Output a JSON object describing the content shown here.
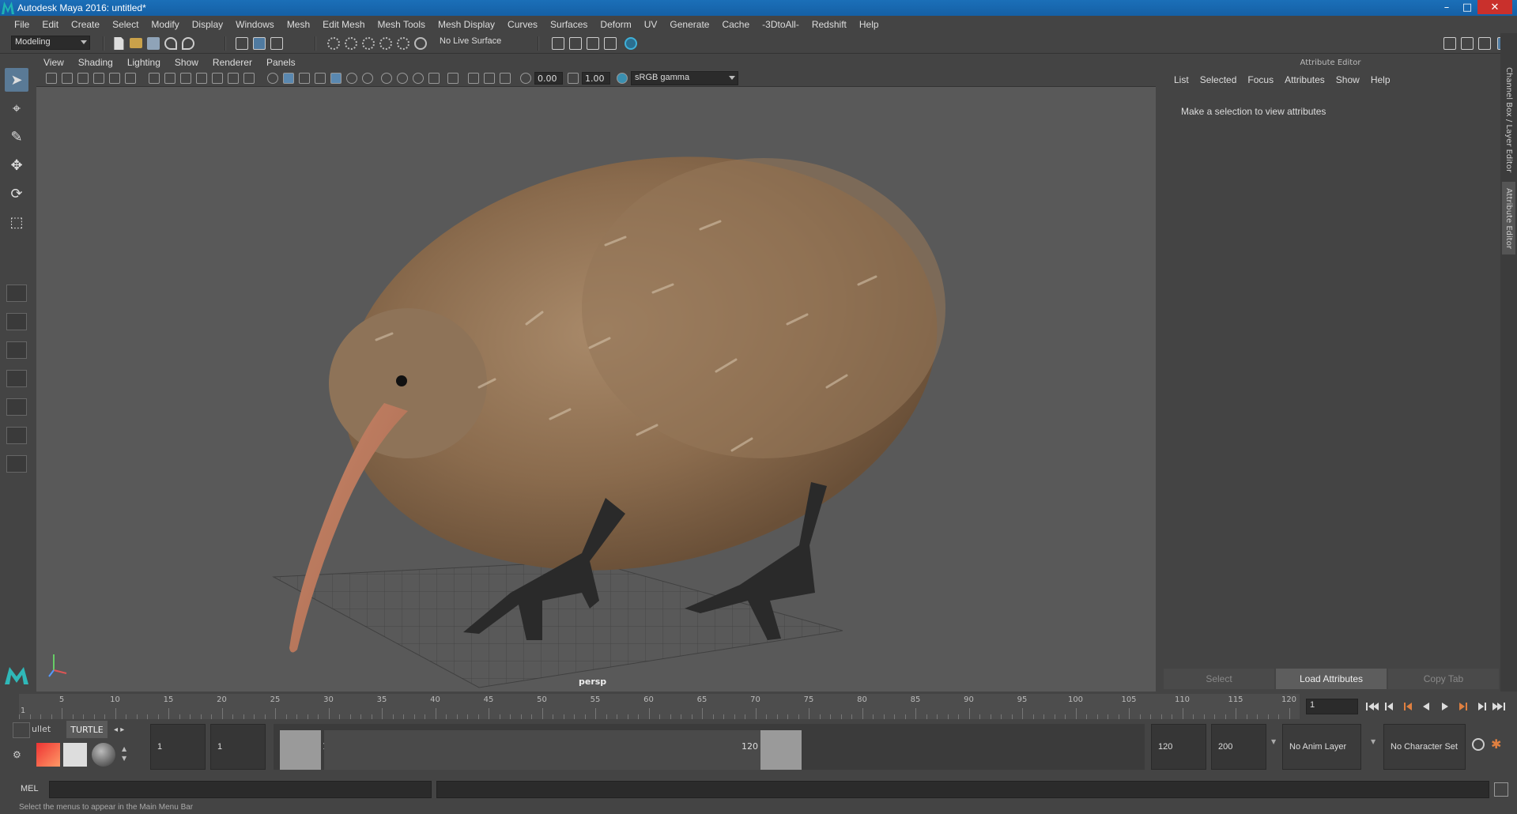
{
  "window": {
    "title": "Autodesk Maya 2016: untitled*"
  },
  "menus": [
    "File",
    "Edit",
    "Create",
    "Select",
    "Modify",
    "Display",
    "Windows",
    "Mesh",
    "Edit Mesh",
    "Mesh Tools",
    "Mesh Display",
    "Curves",
    "Surfaces",
    "Deform",
    "UV",
    "Generate",
    "Cache",
    "-3DtoAll-",
    "Redshift",
    "Help"
  ],
  "shelf": {
    "mode": "Modeling",
    "live_surface": "No Live Surface"
  },
  "viewport": {
    "menus": [
      "View",
      "Shading",
      "Lighting",
      "Show",
      "Renderer",
      "Panels"
    ],
    "exposure": "0.00",
    "gamma": "1.00",
    "colorspace": "sRGB gamma",
    "camera": "persp"
  },
  "attribute_editor": {
    "header": "Attribute Editor",
    "menus": [
      "List",
      "Selected",
      "Focus",
      "Attributes",
      "Show",
      "Help"
    ],
    "message": "Make a selection to view attributes",
    "buttons": {
      "select": "Select",
      "load": "Load Attributes",
      "copy": "Copy Tab"
    },
    "side_tabs": {
      "channel_box": "Channel Box / Layer Editor",
      "attr": "Attribute Editor"
    }
  },
  "timeline": {
    "ticks": [
      "5",
      "10",
      "15",
      "20",
      "25",
      "30",
      "35",
      "40",
      "45",
      "50",
      "55",
      "60",
      "65",
      "70",
      "75",
      "80",
      "85",
      "90",
      "95",
      "100",
      "105",
      "110",
      "115",
      "120"
    ],
    "start_label": "1",
    "current_frame": "1"
  },
  "range": {
    "shelf_tabs": [
      "ullet",
      "TURTLE"
    ],
    "start_time": "1",
    "playback_start": "1",
    "range_start": "1",
    "range_end": "120",
    "playback_end": "120",
    "end_time": "200",
    "anim_layer": "No Anim Layer",
    "character_set": "No Character Set"
  },
  "command": {
    "label": "MEL"
  },
  "help_line": "Select the menus to appear in the Main Menu Bar"
}
